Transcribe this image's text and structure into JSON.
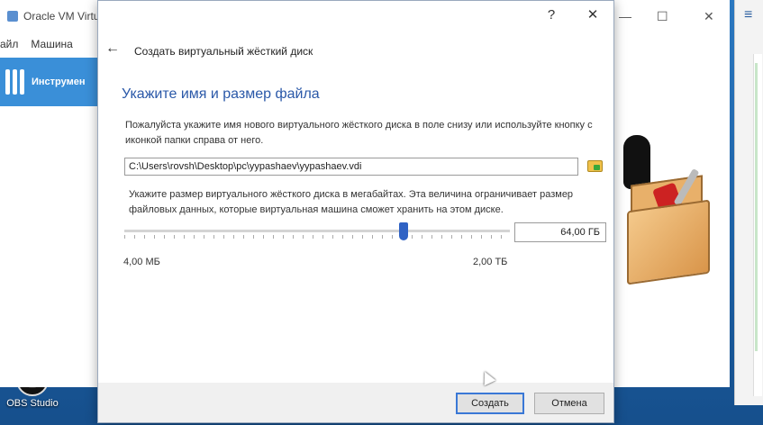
{
  "main_window": {
    "title": "Oracle VM Virtual",
    "menu": [
      "айл",
      "Машина"
    ],
    "tools_label": "Инструмен"
  },
  "desktop": {
    "icon_label": "OBS Studio"
  },
  "dialog": {
    "controls": {
      "help": "?",
      "close": "✕"
    },
    "back_icon": "arrow-left-icon",
    "wizard_title": "Создать виртуальный жёсткий диск",
    "heading": "Укажите имя и размер файла",
    "file_description": "Пожалуйста укажите имя нового виртуального жёсткого диска в поле снизу или используйте кнопку с иконкой папки справа от него.",
    "file_path": "C:\\Users\\rovsh\\Desktop\\pc\\yypashaev\\yypashaev.vdi",
    "size_description": "Укажите размер виртуального жёсткого диска в мегабайтах. Эта величина ограничивает размер файловых данных, которые виртуальная машина сможет хранить на этом диске.",
    "size_value": "64,00 ГБ",
    "slider_fraction": 0.725,
    "range_min": "4,00 МБ",
    "range_max": "2,00 ТБ",
    "buttons": {
      "create": "Создать",
      "cancel": "Отмена"
    }
  },
  "right_window": {
    "controls": {
      "minimize": "—",
      "maximize": "☐",
      "close": "✕"
    },
    "menu_icon": "≡"
  },
  "colors": {
    "heading": "#2a58a8",
    "slider_thumb": "#2f62c4",
    "tools_bg": "#3a8fd8",
    "desktop_bg": "#1f6fb5"
  }
}
